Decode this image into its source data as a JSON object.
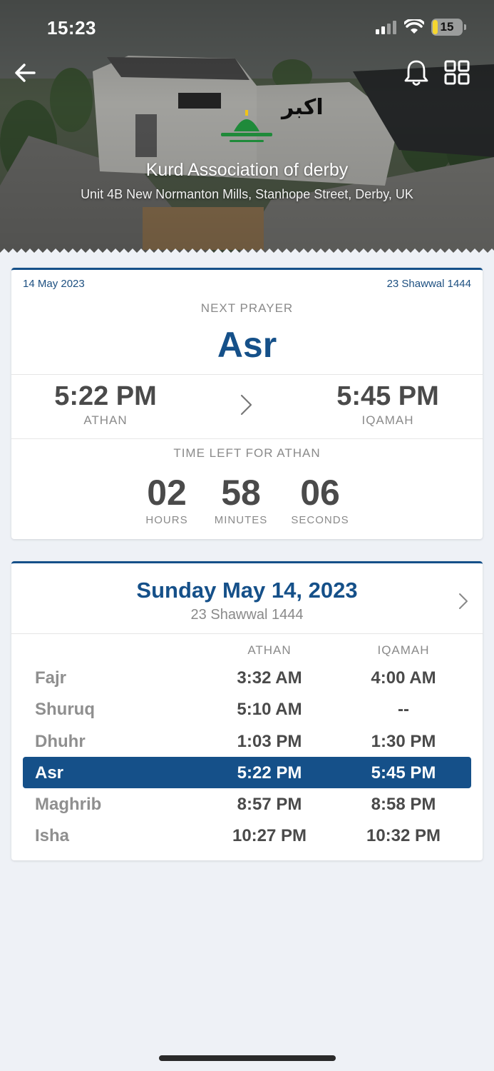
{
  "status_bar": {
    "time": "15:23",
    "battery": "15"
  },
  "header": {
    "masjid_name": "Kurd Association of derby",
    "address": "Unit 4B New Normanton Mills, Stanhope Street, Derby, UK"
  },
  "next_prayer": {
    "gregorian_date": "14 May 2023",
    "hijri_date": "23 Shawwal 1444",
    "label": "NEXT PRAYER",
    "name": "Asr",
    "athan_time": "5:22 PM",
    "athan_label": "ATHAN",
    "iqamah_time": "5:45 PM",
    "iqamah_label": "IQAMAH",
    "time_left_label": "TIME LEFT FOR ATHAN",
    "countdown": {
      "hours": "02",
      "hours_label": "HOURS",
      "minutes": "58",
      "minutes_label": "MINUTES",
      "seconds": "06",
      "seconds_label": "SECONDS"
    }
  },
  "schedule": {
    "date": "Sunday May 14, 2023",
    "hijri": "23 Shawwal 1444",
    "athan_header": "ATHAN",
    "iqamah_header": "IQAMAH",
    "active_prayer": "Asr",
    "rows": [
      {
        "name": "Fajr",
        "athan": "3:32 AM",
        "iqamah": "4:00 AM"
      },
      {
        "name": "Shuruq",
        "athan": "5:10 AM",
        "iqamah": "--"
      },
      {
        "name": "Dhuhr",
        "athan": "1:03 PM",
        "iqamah": "1:30 PM"
      },
      {
        "name": "Asr",
        "athan": "5:22 PM",
        "iqamah": "5:45 PM"
      },
      {
        "name": "Maghrib",
        "athan": "8:57 PM",
        "iqamah": "8:58 PM"
      },
      {
        "name": "Isha",
        "athan": "10:27 PM",
        "iqamah": "10:32 PM"
      }
    ]
  },
  "colors": {
    "accent": "#155089",
    "background": "#eef1f6"
  },
  "icons": [
    "back-arrow-icon",
    "bell-icon",
    "grid-icon",
    "chevron-right-icon",
    "signal-icon",
    "wifi-icon",
    "battery-icon"
  ]
}
